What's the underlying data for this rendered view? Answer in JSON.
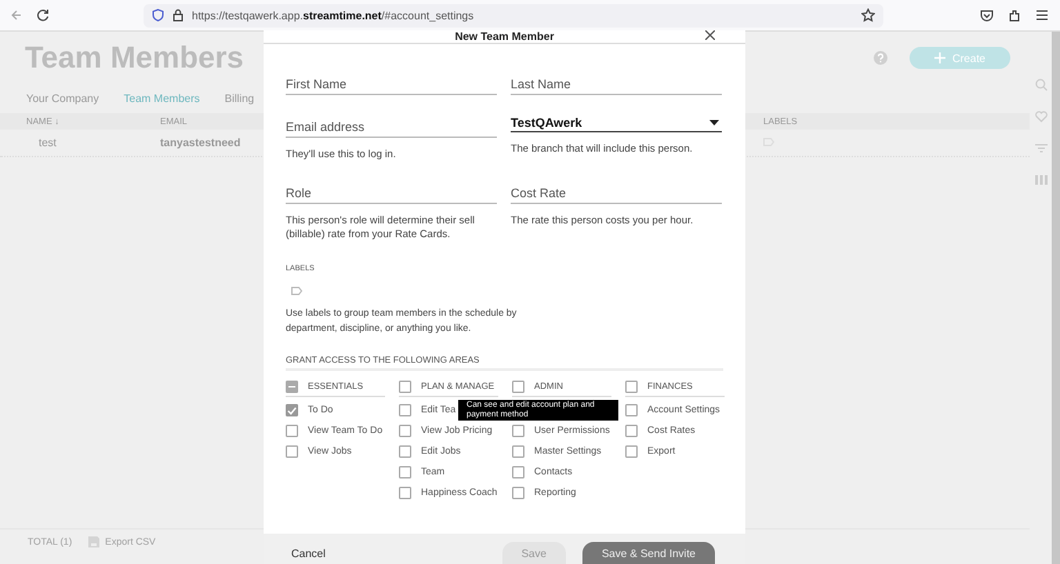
{
  "browser": {
    "url_prefix": "https://testqawerk.app.",
    "url_domain": "streamtime.net",
    "url_suffix": "/#account_settings"
  },
  "page": {
    "title": "Team Members",
    "tabs": [
      {
        "label": "Your Company",
        "selected": false
      },
      {
        "label": "Team Members",
        "selected": true
      },
      {
        "label": "Billing",
        "selected": false
      }
    ],
    "create_button": "Create",
    "table": {
      "columns": [
        "NAME ↓",
        "EMAIL",
        "LABELS"
      ],
      "rows": [
        {
          "name": "test",
          "email": "tanyastestneed"
        }
      ]
    },
    "footer": {
      "total": "TOTAL (1)",
      "export": "Export CSV"
    }
  },
  "modal": {
    "title": "New Team Member",
    "fields": [
      {
        "kind": "text",
        "placeholder": "First Name"
      },
      {
        "kind": "text",
        "placeholder": "Last Name"
      },
      {
        "kind": "text",
        "placeholder": "Email address",
        "help": "They'll use this to log in."
      },
      {
        "kind": "select",
        "value": "TestQAwerk",
        "help": "The branch that will include this person."
      },
      {
        "kind": "text",
        "placeholder": "Role",
        "help": "This person's role will determine their sell (billable) rate from your Rate Cards."
      },
      {
        "kind": "text",
        "placeholder": "Cost Rate",
        "help": "The rate this person costs you per hour."
      }
    ],
    "labels": {
      "heading": "LABELS",
      "hint": "Use labels to group team members in the schedule by department, discipline, or anything you like."
    },
    "access": {
      "heading": "GRANT ACCESS TO THE FOLLOWING AREAS",
      "groups": [
        {
          "title": "ESSENTIALS",
          "partial": true,
          "items": [
            {
              "label": "To Do",
              "checked": true
            },
            {
              "label": "View Team To Do",
              "checked": false
            },
            {
              "label": "View Jobs",
              "checked": false
            }
          ]
        },
        {
          "title": "PLAN & MANAGE",
          "partial": false,
          "items": [
            {
              "label": "Edit Tea",
              "checked": false
            },
            {
              "label": "View Job Pricing",
              "checked": false
            },
            {
              "label": "Edit Jobs",
              "checked": false
            },
            {
              "label": "Team",
              "checked": false
            },
            {
              "label": "Happiness Coach",
              "checked": false
            }
          ]
        },
        {
          "title": "ADMIN",
          "partial": false,
          "items": [
            {
              "label": "User Permissions",
              "checked": false
            },
            {
              "label": "Master Settings",
              "checked": false
            },
            {
              "label": "Contacts",
              "checked": false
            },
            {
              "label": "Reporting",
              "checked": false
            }
          ]
        },
        {
          "title": "FINANCES",
          "partial": false,
          "items": [
            {
              "label": "Account Settings",
              "checked": false
            },
            {
              "label": "Cost Rates",
              "checked": false
            },
            {
              "label": "Export",
              "checked": false
            }
          ]
        }
      ]
    },
    "tooltip": "Can see and edit account plan and payment method",
    "buttons": {
      "cancel": "Cancel",
      "save": "Save",
      "save_disabled": true,
      "send": "Save & Send Invite"
    }
  }
}
